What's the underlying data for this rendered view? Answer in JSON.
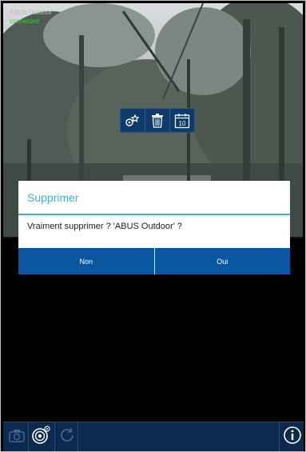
{
  "camera": {
    "name": "ABUS Outdoor",
    "status": "connected",
    "toolbar": {
      "items": [
        {
          "name": "ptz-settings-icon"
        },
        {
          "name": "trash-icon"
        },
        {
          "name": "calendar-icon",
          "day": "10"
        }
      ]
    }
  },
  "dialog": {
    "title": "Supprimer",
    "message": "Vraiment supprimer ? 'ABUS Outdoor' ?",
    "no_label": "Non",
    "yes_label": "Oui"
  },
  "bottom_bar": {
    "icons": [
      "camera-icon",
      "lens-settings-icon",
      "refresh-icon",
      "info-icon"
    ]
  },
  "colors": {
    "accent": "#33b5e5",
    "button": "#0a56a0",
    "toolbar": "#0e3a6c",
    "bottom_bar": "#0c2a4d",
    "status": "#39c839"
  }
}
